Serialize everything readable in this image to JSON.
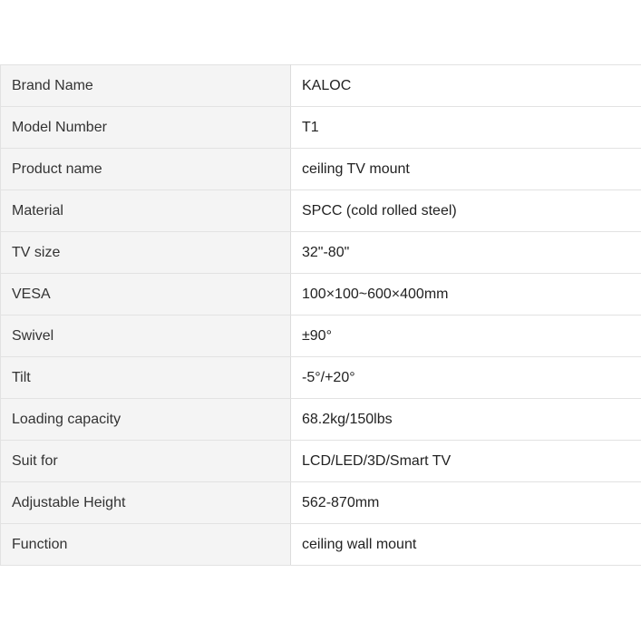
{
  "spec_table": {
    "rows": [
      {
        "label": "Brand Name",
        "value": "KALOC"
      },
      {
        "label": "Model Number",
        "value": "T1"
      },
      {
        "label": "Product name",
        "value": "ceiling TV mount"
      },
      {
        "label": "Material",
        "value": "SPCC (cold rolled steel)"
      },
      {
        "label": "TV size",
        "value": "32\"-80\""
      },
      {
        "label": "VESA",
        "value": "100×100~600×400mm"
      },
      {
        "label": "Swivel",
        "value": "±90°"
      },
      {
        "label": "Tilt",
        "value": "-5°/+20°"
      },
      {
        "label": "Loading capacity",
        "value": "68.2kg/150lbs"
      },
      {
        "label": "Suit for",
        "value": "LCD/LED/3D/Smart TV"
      },
      {
        "label": "Adjustable Height",
        "value": "562-870mm"
      },
      {
        "label": "Function",
        "value": "ceiling wall mount"
      }
    ]
  },
  "colors": {
    "label_background": "#f4f4f4",
    "value_background": "#ffffff",
    "border": "#e2e2e2",
    "text": "#222222"
  }
}
